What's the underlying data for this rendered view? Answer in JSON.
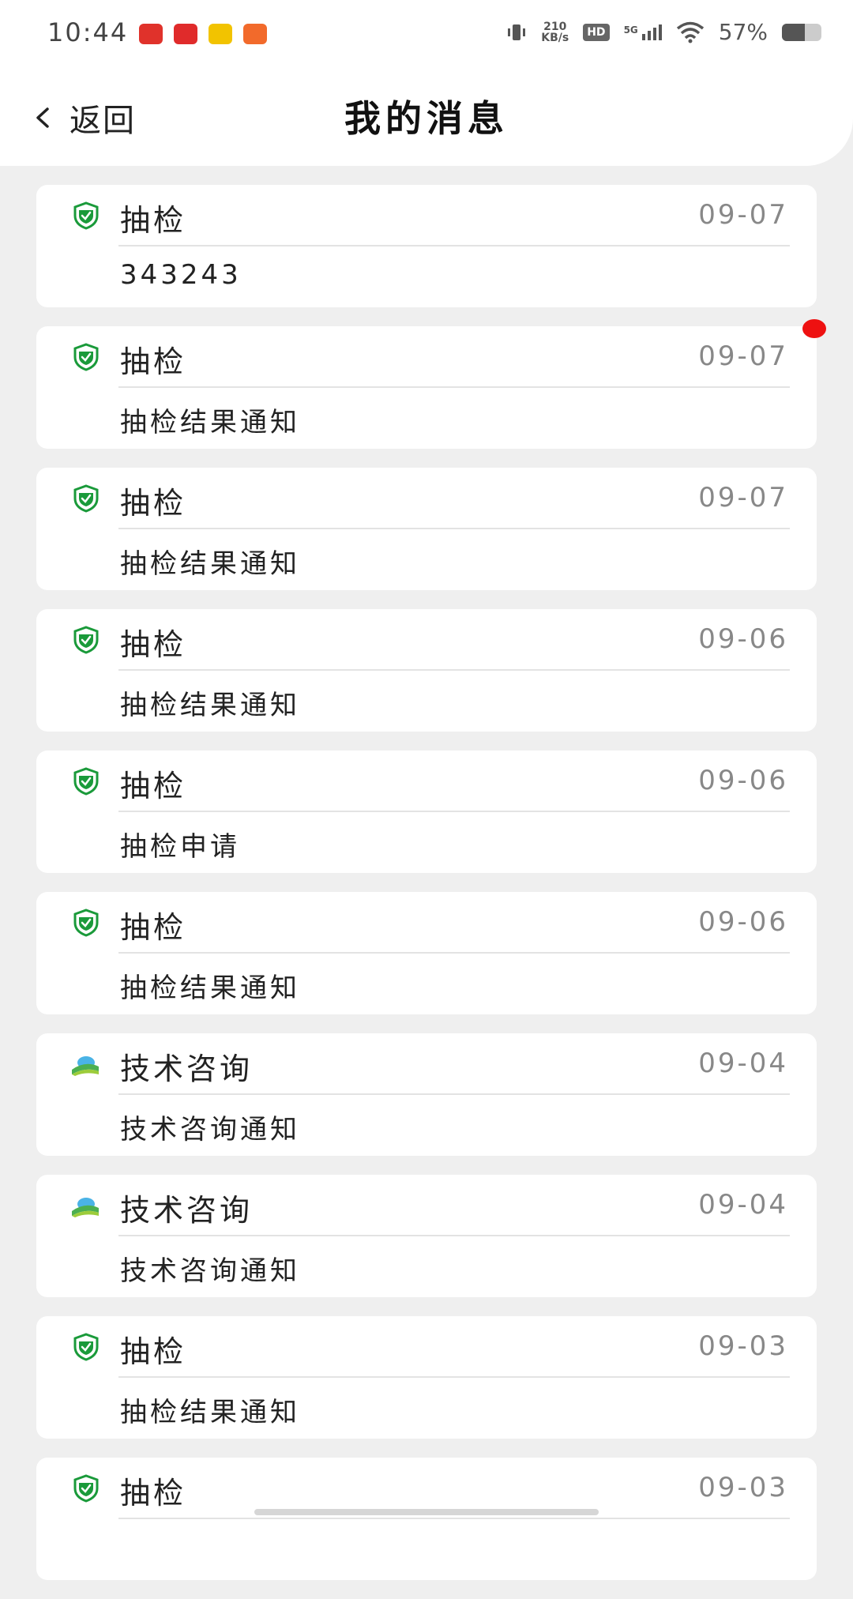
{
  "status": {
    "time": "10:44",
    "net_speed_top": "210",
    "net_speed_bottom": "KB/s",
    "hd": "HD",
    "network": "5G",
    "battery_text": "57%",
    "battery_level": 0.57,
    "notification_icon_colors": [
      "#e0322b",
      "#e02b2b",
      "#f2c300",
      "#f26a2b"
    ]
  },
  "header": {
    "back_label": "返回",
    "title": "我的消息"
  },
  "colors": {
    "shield": "#1a9a3a",
    "unread": "#ee1111"
  },
  "messages": [
    {
      "icon": "shield-check-icon",
      "title": "抽检",
      "date": "09-07",
      "body": "343243"
    },
    {
      "icon": "shield-check-icon",
      "title": "抽检",
      "date": "09-07",
      "body": "抽检结果通知"
    },
    {
      "icon": "shield-check-icon",
      "title": "抽检",
      "date": "09-07",
      "body": "抽检结果通知"
    },
    {
      "icon": "shield-check-icon",
      "title": "抽检",
      "date": "09-06",
      "body": "抽检结果通知"
    },
    {
      "icon": "shield-check-icon",
      "title": "抽检",
      "date": "09-06",
      "body": "抽检申请"
    },
    {
      "icon": "shield-check-icon",
      "title": "抽检",
      "date": "09-06",
      "body": "抽检结果通知"
    },
    {
      "icon": "farmland-icon",
      "title": "技术咨询",
      "date": "09-04",
      "body": "技术咨询通知"
    },
    {
      "icon": "farmland-icon",
      "title": "技术咨询",
      "date": "09-04",
      "body": "技术咨询通知"
    },
    {
      "icon": "shield-check-icon",
      "title": "抽检",
      "date": "09-03",
      "body": "抽检结果通知"
    },
    {
      "icon": "shield-check-icon",
      "title": "抽检",
      "date": "09-03",
      "body": ""
    }
  ]
}
